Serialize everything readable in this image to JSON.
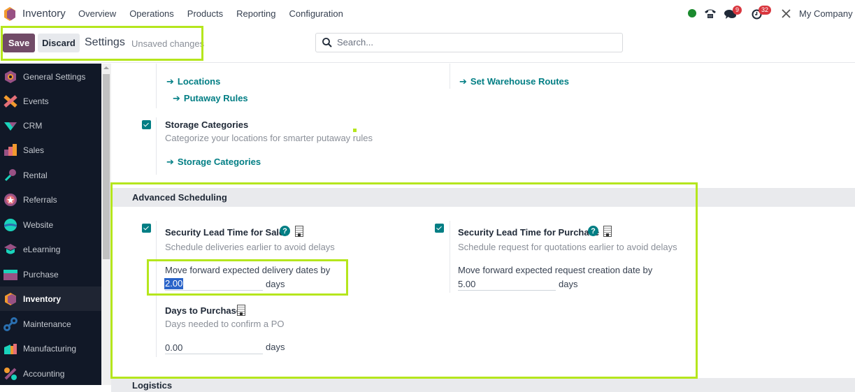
{
  "navbar": {
    "app_name": "Inventory",
    "menu": [
      "Overview",
      "Operations",
      "Products",
      "Reporting",
      "Configuration"
    ],
    "status_color": "#1b8a2e",
    "messages_badge": "9",
    "activities_badge": "32",
    "company": "My Company ("
  },
  "control_panel": {
    "save_label": "Save",
    "discard_label": "Discard",
    "title": "Settings",
    "status": "Unsaved changes",
    "search_placeholder": "Search..."
  },
  "sidebar": {
    "items": [
      {
        "label": "General Settings",
        "icon": "general-settings-icon",
        "active": false
      },
      {
        "label": "Events",
        "icon": "events-icon",
        "active": false
      },
      {
        "label": "CRM",
        "icon": "crm-icon",
        "active": false
      },
      {
        "label": "Sales",
        "icon": "sales-icon",
        "active": false
      },
      {
        "label": "Rental",
        "icon": "rental-icon",
        "active": false
      },
      {
        "label": "Referrals",
        "icon": "referrals-icon",
        "active": false
      },
      {
        "label": "Website",
        "icon": "website-icon",
        "active": false
      },
      {
        "label": "eLearning",
        "icon": "elearning-icon",
        "active": false
      },
      {
        "label": "Purchase",
        "icon": "purchase-icon",
        "active": false
      },
      {
        "label": "Inventory",
        "icon": "inventory-icon",
        "active": true
      },
      {
        "label": "Maintenance",
        "icon": "maintenance-icon",
        "active": false
      },
      {
        "label": "Manufacturing",
        "icon": "manufacturing-icon",
        "active": false
      },
      {
        "label": "Accounting",
        "icon": "accounting-icon",
        "active": false
      }
    ]
  },
  "warehouse": {
    "locations_link": "Locations",
    "putaway_link": "Putaway Rules",
    "routes_link": "Set Warehouse Routes",
    "storage_title": "Storage Categories",
    "storage_desc": "Categorize your locations for smarter putaway rules",
    "storage_link": "Storage Categories",
    "storage_checked": true
  },
  "advanced_scheduling": {
    "section_title": "Advanced Scheduling",
    "sales": {
      "title": "Security Lead Time for Sales",
      "desc": "Schedule deliveries earlier to avoid delays",
      "field_label": "Move forward expected delivery dates by",
      "value": "2.00",
      "unit": "days",
      "checked": true
    },
    "purchase": {
      "title": "Security Lead Time for Purchase",
      "desc": "Schedule request for quotations earlier to avoid delays",
      "field_label": "Move forward expected request creation date by",
      "value": "5.00",
      "unit": "days",
      "checked": true
    },
    "days_to_purchase": {
      "title": "Days to Purchase",
      "desc": "Days needed to confirm a PO",
      "value": "0.00",
      "unit": "days"
    }
  },
  "next_section_title": "Logistics",
  "help_glyph": "?",
  "arrow_glyph": "➔",
  "highlight_color": "#b5e61d"
}
